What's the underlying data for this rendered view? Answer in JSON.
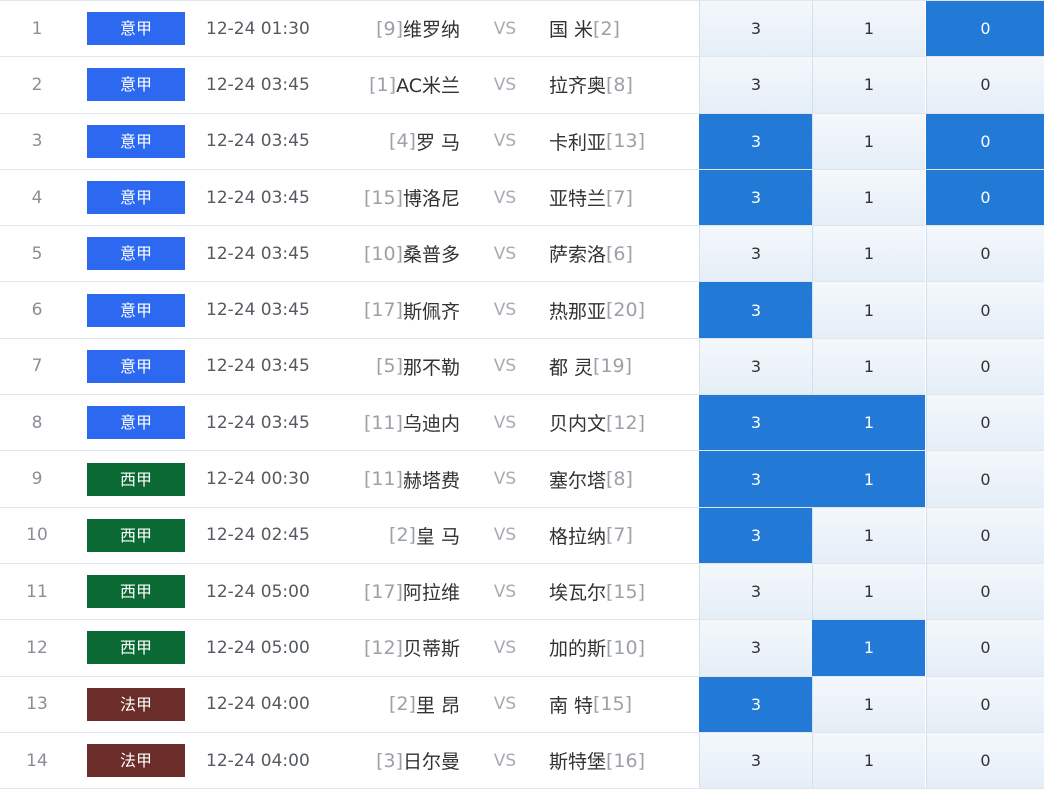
{
  "colors": {
    "serie_a": "#2c68f0",
    "la_liga": "#0b6a33",
    "ligue_1": "#6a2d2a",
    "selected_odds": "#2279d6"
  },
  "matches": [
    {
      "num": "1",
      "league": "意甲",
      "league_color": "#2c68f0",
      "time": "12-24 01:30",
      "home_rank": "[9]",
      "home": "维罗纳",
      "vs": "VS",
      "away": "国 米",
      "away_rank": "[2]",
      "o1": "3",
      "o2": "1",
      "o3": "0",
      "sel": [
        false,
        false,
        true
      ]
    },
    {
      "num": "2",
      "league": "意甲",
      "league_color": "#2c68f0",
      "time": "12-24 03:45",
      "home_rank": "[1]",
      "home": "AC米兰",
      "vs": "VS",
      "away": "拉齐奥",
      "away_rank": "[8]",
      "o1": "3",
      "o2": "1",
      "o3": "0",
      "sel": [
        false,
        false,
        false
      ]
    },
    {
      "num": "3",
      "league": "意甲",
      "league_color": "#2c68f0",
      "time": "12-24 03:45",
      "home_rank": "[4]",
      "home": "罗 马",
      "vs": "VS",
      "away": "卡利亚",
      "away_rank": "[13]",
      "o1": "3",
      "o2": "1",
      "o3": "0",
      "sel": [
        true,
        false,
        true
      ]
    },
    {
      "num": "4",
      "league": "意甲",
      "league_color": "#2c68f0",
      "time": "12-24 03:45",
      "home_rank": "[15]",
      "home": "博洛尼",
      "vs": "VS",
      "away": "亚特兰",
      "away_rank": "[7]",
      "o1": "3",
      "o2": "1",
      "o3": "0",
      "sel": [
        true,
        false,
        true
      ]
    },
    {
      "num": "5",
      "league": "意甲",
      "league_color": "#2c68f0",
      "time": "12-24 03:45",
      "home_rank": "[10]",
      "home": "桑普多",
      "vs": "VS",
      "away": "萨索洛",
      "away_rank": "[6]",
      "o1": "3",
      "o2": "1",
      "o3": "0",
      "sel": [
        false,
        false,
        false
      ]
    },
    {
      "num": "6",
      "league": "意甲",
      "league_color": "#2c68f0",
      "time": "12-24 03:45",
      "home_rank": "[17]",
      "home": "斯佩齐",
      "vs": "VS",
      "away": "热那亚",
      "away_rank": "[20]",
      "o1": "3",
      "o2": "1",
      "o3": "0",
      "sel": [
        true,
        false,
        false
      ]
    },
    {
      "num": "7",
      "league": "意甲",
      "league_color": "#2c68f0",
      "time": "12-24 03:45",
      "home_rank": "[5]",
      "home": "那不勒",
      "vs": "VS",
      "away": "都 灵",
      "away_rank": "[19]",
      "o1": "3",
      "o2": "1",
      "o3": "0",
      "sel": [
        false,
        false,
        false
      ]
    },
    {
      "num": "8",
      "league": "意甲",
      "league_color": "#2c68f0",
      "time": "12-24 03:45",
      "home_rank": "[11]",
      "home": "乌迪内",
      "vs": "VS",
      "away": "贝内文",
      "away_rank": "[12]",
      "o1": "3",
      "o2": "1",
      "o3": "0",
      "sel": [
        true,
        true,
        false
      ]
    },
    {
      "num": "9",
      "league": "西甲",
      "league_color": "#0b6a33",
      "time": "12-24 00:30",
      "home_rank": "[11]",
      "home": "赫塔费",
      "vs": "VS",
      "away": "塞尔塔",
      "away_rank": "[8]",
      "o1": "3",
      "o2": "1",
      "o3": "0",
      "sel": [
        true,
        true,
        false
      ]
    },
    {
      "num": "10",
      "league": "西甲",
      "league_color": "#0b6a33",
      "time": "12-24 02:45",
      "home_rank": "[2]",
      "home": "皇 马",
      "vs": "VS",
      "away": "格拉纳",
      "away_rank": "[7]",
      "o1": "3",
      "o2": "1",
      "o3": "0",
      "sel": [
        true,
        false,
        false
      ]
    },
    {
      "num": "11",
      "league": "西甲",
      "league_color": "#0b6a33",
      "time": "12-24 05:00",
      "home_rank": "[17]",
      "home": "阿拉维",
      "vs": "VS",
      "away": "埃瓦尔",
      "away_rank": "[15]",
      "o1": "3",
      "o2": "1",
      "o3": "0",
      "sel": [
        false,
        false,
        false
      ]
    },
    {
      "num": "12",
      "league": "西甲",
      "league_color": "#0b6a33",
      "time": "12-24 05:00",
      "home_rank": "[12]",
      "home": "贝蒂斯",
      "vs": "VS",
      "away": "加的斯",
      "away_rank": "[10]",
      "o1": "3",
      "o2": "1",
      "o3": "0",
      "sel": [
        false,
        true,
        false
      ]
    },
    {
      "num": "13",
      "league": "法甲",
      "league_color": "#6a2d2a",
      "time": "12-24 04:00",
      "home_rank": "[2]",
      "home": "里 昂",
      "vs": "VS",
      "away": "南 特",
      "away_rank": "[15]",
      "o1": "3",
      "o2": "1",
      "o3": "0",
      "sel": [
        true,
        false,
        false
      ]
    },
    {
      "num": "14",
      "league": "法甲",
      "league_color": "#6a2d2a",
      "time": "12-24 04:00",
      "home_rank": "[3]",
      "home": "日尔曼",
      "vs": "VS",
      "away": "斯特堡",
      "away_rank": "[16]",
      "o1": "3",
      "o2": "1",
      "o3": "0",
      "sel": [
        false,
        false,
        false
      ]
    }
  ]
}
